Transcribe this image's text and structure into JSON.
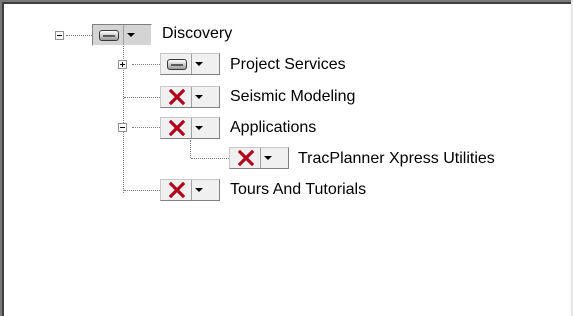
{
  "tree": {
    "nodes": [
      {
        "label": "Discovery",
        "status": "installed",
        "expander": "collapse"
      },
      {
        "label": "Project Services",
        "status": "installed",
        "expander": "expand"
      },
      {
        "label": "Seismic Modeling",
        "status": "not-installed",
        "expander": "none"
      },
      {
        "label": "Applications",
        "status": "not-installed",
        "expander": "collapse"
      },
      {
        "label": "TracPlanner Xpress Utilities",
        "status": "not-installed",
        "expander": "none"
      },
      {
        "label": "Tours And Tutorials",
        "status": "not-installed",
        "expander": "none"
      }
    ]
  },
  "icons": {
    "installed": "drive-icon",
    "not_installed": "red-x-icon",
    "dropdown": "dropdown-arrow-icon"
  },
  "colors": {
    "x_red": "#b0001a",
    "tree_line": "#808080"
  }
}
